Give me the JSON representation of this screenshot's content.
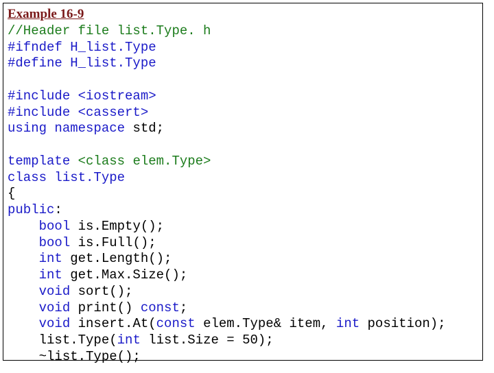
{
  "title": "Example 16-9",
  "lines": {
    "l1": "//Header file list.Type. h",
    "l2": "#ifndef H_list.Type",
    "l3": "#define H_list.Type",
    "l4": "",
    "l5": "#include <iostream>",
    "l6": "#include <cassert>",
    "l7_a": "using namespace ",
    "l7_b": "std;",
    "l8": "",
    "l9_a": "template ",
    "l9_b": "<class elem.Type>",
    "l10": "class list.Type",
    "l11": "{",
    "l12_a": "public",
    "l12_b": ":",
    "l13_a": "    bool ",
    "l13_b": "is.Empty();",
    "l14_a": "    bool ",
    "l14_b": "is.Full();",
    "l15_a": "    int ",
    "l15_b": "get.Length();",
    "l16_a": "    int ",
    "l16_b": "get.Max.Size();",
    "l17_a": "    void ",
    "l17_b": "sort();",
    "l18_a": "    void ",
    "l18_b": "print() ",
    "l18_c": "const",
    "l18_d": ";",
    "l19_a": "    void ",
    "l19_b": "insert.At(",
    "l19_c": "const ",
    "l19_d": "elem.Type& item, ",
    "l19_e": "int ",
    "l19_f": "position);",
    "l20_a": "    list.Type(",
    "l20_b": "int ",
    "l20_c": "list.Size = 50);",
    "l21": "    ~list.Type();"
  }
}
